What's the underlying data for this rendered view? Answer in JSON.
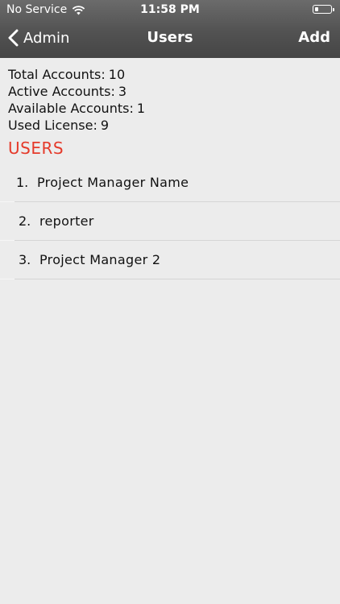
{
  "status_bar": {
    "carrier": "No Service",
    "time": "11:58 PM",
    "battery_level": 0.2
  },
  "nav": {
    "back_label": "Admin",
    "title": "Users",
    "add_label": "Add"
  },
  "stats": [
    {
      "label": "Total Accounts:",
      "value": "10"
    },
    {
      "label": "Active Accounts:",
      "value": "3"
    },
    {
      "label": "Available Accounts:",
      "value": "1"
    },
    {
      "label": "Used License:",
      "value": "9"
    }
  ],
  "section": {
    "title": "USERS",
    "title_color": "#e53a2a"
  },
  "users": [
    {
      "number": "1.",
      "name": "Project Manager Name"
    },
    {
      "number": "2.",
      "name": "reporter"
    },
    {
      "number": "3.",
      "name": "Project Manager 2"
    }
  ],
  "icons": {
    "wifi": "wifi-icon",
    "battery": "battery-icon",
    "back": "chevron-left-icon"
  }
}
